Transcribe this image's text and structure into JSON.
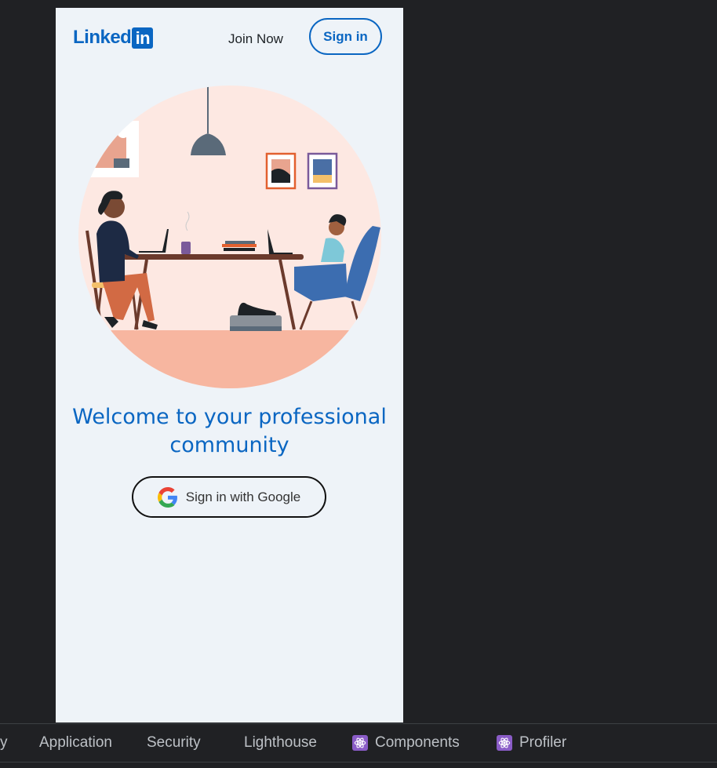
{
  "header": {
    "logo_text": "Linked",
    "logo_in": "in",
    "join_now_label": "Join Now",
    "sign_in_label": "Sign in"
  },
  "main": {
    "welcome_title": "Welcome to your professional community",
    "google_signin_label": "Sign in with Google"
  },
  "devtools": {
    "tabs": [
      {
        "label": "y",
        "icon": null
      },
      {
        "label": "Application",
        "icon": null
      },
      {
        "label": "Security",
        "icon": null
      },
      {
        "label": "Lighthouse",
        "icon": null
      },
      {
        "label": "Components",
        "icon": "react-icon"
      },
      {
        "label": "Profiler",
        "icon": "react-icon"
      }
    ]
  },
  "colors": {
    "brand": "#0a66c2",
    "page_background": "#eef3f8",
    "devtools_background": "#202124"
  }
}
